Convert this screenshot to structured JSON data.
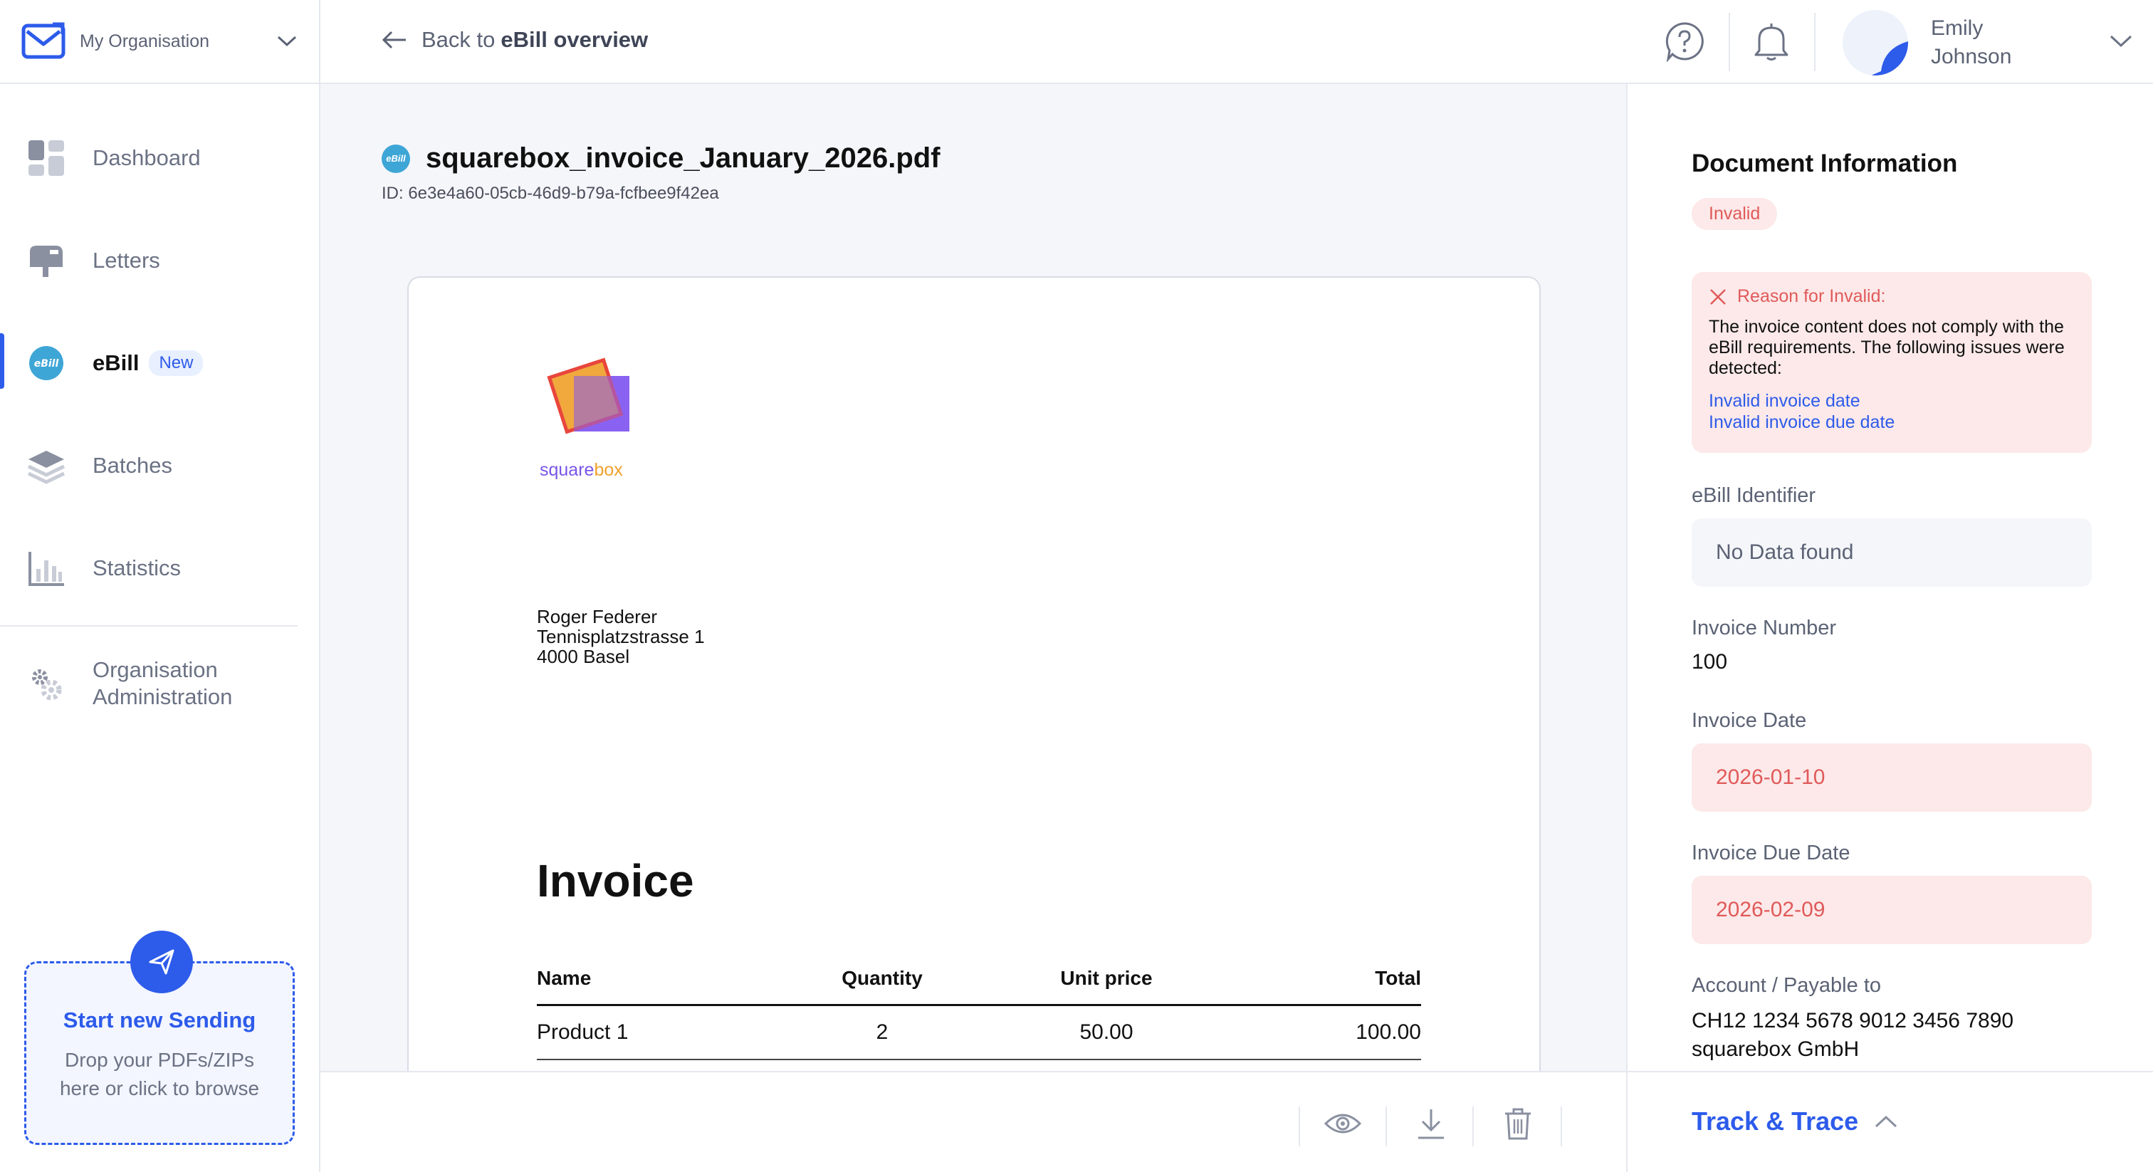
{
  "org": {
    "name": "My Organisation"
  },
  "nav": {
    "dashboard": "Dashboard",
    "letters": "Letters",
    "ebill": "eBill",
    "ebill_badge": "New",
    "batches": "Batches",
    "statistics": "Statistics",
    "org_admin_line1": "Organisation",
    "org_admin_line2": "Administration"
  },
  "upload": {
    "title": "Start new Sending",
    "sub_line1": "Drop your PDFs/ZIPs",
    "sub_line2": "here or click to browse"
  },
  "topbar": {
    "back_prefix": "Back to",
    "back_target": "eBill overview",
    "user_first": "Emily",
    "user_last": "Johnson"
  },
  "document": {
    "badge_text": "eBill",
    "file_name": "squarebox_invoice_January_2026.pdf",
    "id_text": "ID: 6e3e4a60-05cb-46d9-b79a-fcfbee9f42ea"
  },
  "invoice": {
    "logo_part1": "square",
    "logo_part2": "box",
    "address": [
      "Roger Federer",
      "Tennisplatzstrasse 1",
      "4000 Basel"
    ],
    "heading": "Invoice",
    "columns": [
      "Name",
      "Quantity",
      "Unit price",
      "Total"
    ],
    "rows": [
      [
        "Product 1",
        "2",
        "50.00",
        "100.00"
      ]
    ]
  },
  "panel": {
    "title": "Document Information",
    "status": "Invalid",
    "reason_title": "Reason for Invalid:",
    "reason_body": "The invoice content does not comply with the eBill requirements. The following issues were detected:",
    "issues": [
      "Invalid invoice date",
      "Invalid invoice due date"
    ],
    "ebill_identifier_label": "eBill Identifier",
    "ebill_identifier_value": "No Data found",
    "invoice_number_label": "Invoice Number",
    "invoice_number_value": "100",
    "invoice_date_label": "Invoice Date",
    "invoice_date_value": "2026-01-10",
    "invoice_due_label": "Invoice Due Date",
    "invoice_due_value": "2026-02-09",
    "account_label": "Account / Payable to",
    "account_line1": "CH12 1234 5678 9012 3456 7890",
    "account_line2": "squarebox GmbH"
  },
  "track": {
    "label": "Track & Trace"
  },
  "colors": {
    "accent": "#2d5bea",
    "error": "#e05a5a",
    "error_bg": "#fde9e9",
    "ebill": "#3ea6d6"
  }
}
